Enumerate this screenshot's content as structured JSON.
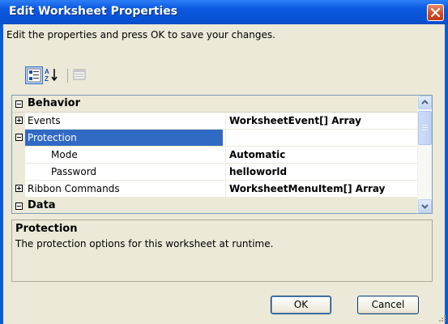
{
  "window": {
    "title": "Edit Worksheet Properties"
  },
  "instructions": "Edit the properties and press OK to save your changes.",
  "toolbar": {
    "buttons": [
      {
        "name": "categorized-view",
        "active": true
      },
      {
        "name": "alphabetical-view",
        "active": false
      },
      {
        "name": "property-pages",
        "active": false
      }
    ]
  },
  "grid": {
    "rows": [
      {
        "type": "category",
        "label": "Behavior",
        "expanded": true
      },
      {
        "type": "property",
        "label": "Events",
        "value": "WorksheetEvent[] Array",
        "expander": "plus"
      },
      {
        "type": "property",
        "label": "Protection",
        "value": "",
        "expander": "minus",
        "selected": true
      },
      {
        "type": "sub",
        "label": "Mode",
        "value": "Automatic"
      },
      {
        "type": "sub",
        "label": "Password",
        "value": "helloworld"
      },
      {
        "type": "property",
        "label": "Ribbon Commands",
        "value": "WorksheetMenuItem[] Array",
        "expander": "plus"
      },
      {
        "type": "category",
        "label": "Data",
        "expanded": true
      }
    ]
  },
  "help": {
    "title": "Protection",
    "description": "The protection options for this worksheet at runtime."
  },
  "buttons": {
    "ok": "OK",
    "cancel": "Cancel"
  },
  "colors": {
    "titlebar": "#0a5bd7",
    "selection": "#316ac5",
    "face": "#ece9d8"
  }
}
